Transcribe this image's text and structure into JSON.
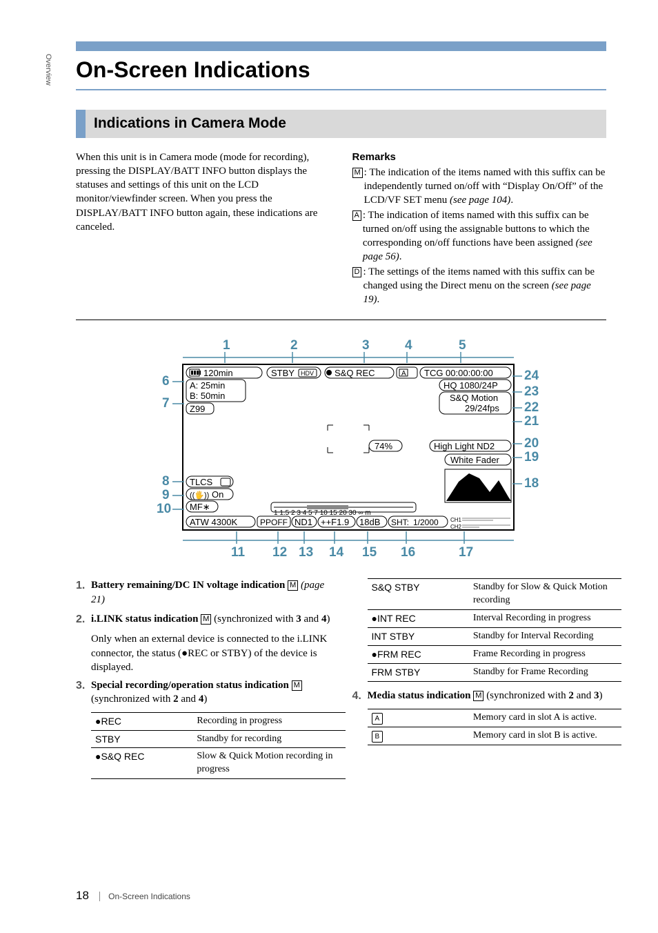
{
  "side_label": "Overview",
  "title": "On-Screen Indications",
  "section_heading": "Indications in Camera Mode",
  "intro_para": "When this unit is in Camera mode (mode for recording), pressing the DISPLAY/BATT INFO button displays the statuses and settings of this unit on the LCD monitor/viewfinder screen. When you press the DISPLAY/BATT INFO button again, these indications are canceled.",
  "remarks_heading": "Remarks",
  "remarks": [
    {
      "letter": "M",
      "text": ": The indication of the items named with this suffix can be independently turned on/off with “Display On/Off” of the LCD/VF SET menu ",
      "italic": "(see page 104)",
      "tail": "."
    },
    {
      "letter": "A",
      "text": ": The indication of items named with this suffix can be turned on/off using the assignable buttons to which the corresponding on/off functions have been assigned ",
      "italic": "(see page 56)",
      "tail": "."
    },
    {
      "letter": "D",
      "text": ": The settings of the items named with this suffix can be changed using the Direct menu on the screen ",
      "italic": "(see page 19)",
      "tail": "."
    }
  ],
  "diagram": {
    "top_nums": [
      "1",
      "2",
      "3",
      "4",
      "5"
    ],
    "left_nums": [
      "6",
      "7",
      "8",
      "9",
      "10"
    ],
    "right_nums": [
      "24",
      "23",
      "22",
      "21",
      "20",
      "19",
      "18"
    ],
    "bottom_nums": [
      "11",
      "12",
      "13",
      "14",
      "15",
      "16",
      "17"
    ],
    "battery": "120min",
    "stby": "STBY",
    "hdv": "HDV",
    "sqrec": "S&Q REC",
    "a_tab": "A",
    "tcg": "TCG 00:00:00:00",
    "a_line": "A:  25min",
    "b_line": "B:  50min",
    "z": "Z99",
    "hq": "HQ 1080/24P",
    "sqm": "S&Q Motion",
    "fps": "29/24fps",
    "pct": "74%",
    "hl": "High Light ND2",
    "wf": "White Fader",
    "tlcs": "TLCS",
    "steady": "On",
    "mf": "MF∗",
    "scale": "1  1.5 2    3  4 5    7 10   15 20  30    ∞ m",
    "atw": "ATW 4300K",
    "ppoff": "PPOFF",
    "nd": "ND1",
    "f": "++F1.9",
    "db": "18dB",
    "sht": "SHT:",
    "shutter": "1/2000",
    "ch1": "CH1",
    "ch2": "CH2"
  },
  "items": [
    {
      "num": "1.",
      "bold": "Battery remaining/DC IN voltage indication ",
      "letter": "M",
      "italic": " (page 21)"
    },
    {
      "num": "2.",
      "bold": "i.LINK status indication ",
      "letter": "M",
      "plain": " (synchronized with ",
      "b1": "3",
      "mid": " and ",
      "b2": "4",
      "close": ")",
      "para": "Only when an external device is connected to the i.LINK connector, the status (●REC or STBY) of the device is displayed."
    },
    {
      "num": "3.",
      "bold": "Special recording/operation status indication ",
      "letter": "M",
      "plain": " (synchronized with ",
      "b1": "2",
      "mid": " and ",
      "b2": "4",
      "close": ")"
    },
    {
      "num": "4.",
      "bold": "Media status indication ",
      "letter": "M",
      "plain": " (synchronized with ",
      "b1": "2",
      "mid": " and ",
      "b2": "3",
      "close": ")"
    }
  ],
  "table_left": [
    {
      "k": "●REC",
      "v": "Recording in progress"
    },
    {
      "k": "STBY",
      "v": "Standby for recording"
    },
    {
      "k": "●S&Q REC",
      "v": "Slow & Quick Motion recording in progress"
    }
  ],
  "table_right_a": [
    {
      "k": "S&Q STBY",
      "v": "Standby for Slow & Quick Motion recording"
    },
    {
      "k": "●INT REC",
      "v": "Interval Recording in progress"
    },
    {
      "k": "INT STBY",
      "v": "Standby for Interval Recording"
    },
    {
      "k": "●FRM REC",
      "v": "Frame Recording in progress"
    },
    {
      "k": "FRM STBY",
      "v": "Standby for Frame Recording"
    }
  ],
  "media_rows": [
    {
      "icon": "A",
      "text": "Memory card in slot A is active."
    },
    {
      "icon": "B",
      "text": "Memory card in slot B is active."
    }
  ],
  "footer": {
    "page": "18",
    "title": "On-Screen Indications"
  }
}
